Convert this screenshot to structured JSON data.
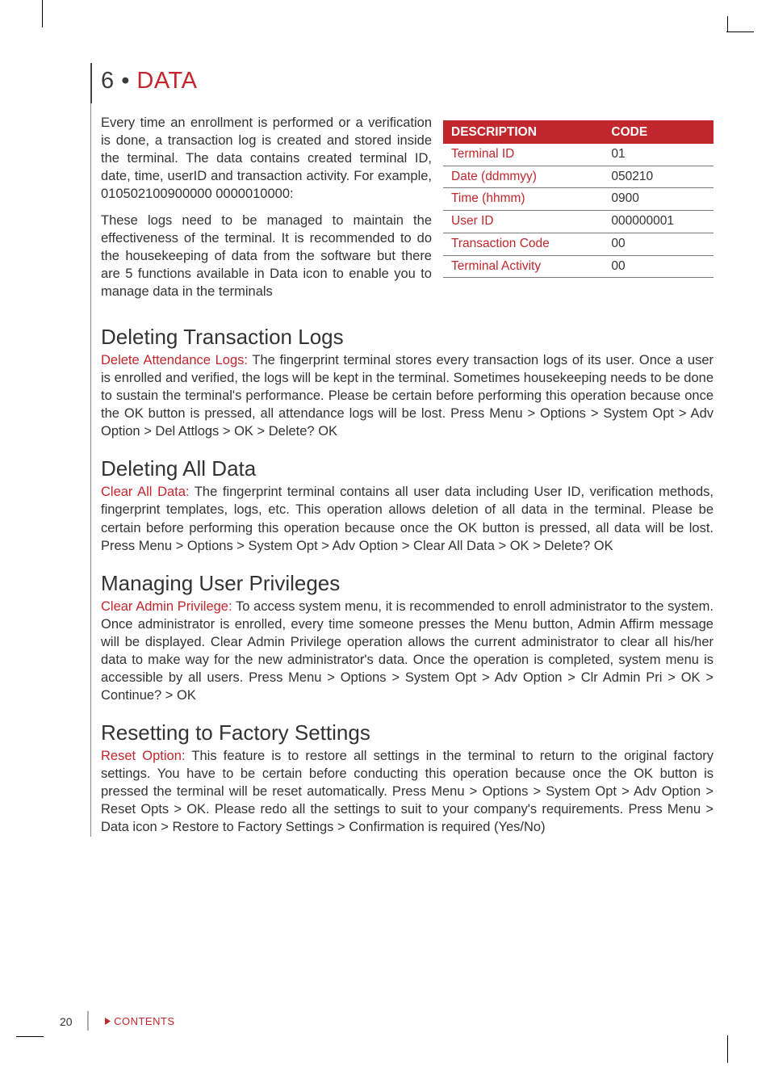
{
  "chapter": {
    "number": "6",
    "separator": "•",
    "title": "DATA"
  },
  "intro": {
    "p1": "Every time an enrollment is performed or a verification is done, a transaction log is created and stored inside the terminal. The data contains created terminal ID, date, time, userID and transaction activity. For example, 010502100900000 0000010000:",
    "p2": "These logs need to be managed to maintain the effectiveness of the terminal. It is recommended to do the housekeeping of data from the software but there are 5 functions available in Data icon to enable you to manage data in the terminals"
  },
  "table": {
    "headers": {
      "desc": "DESCRIPTION",
      "code": "CODE"
    },
    "rows": [
      {
        "desc": "Terminal ID",
        "code": "01"
      },
      {
        "desc": "Date (ddmmyy)",
        "code": "050210"
      },
      {
        "desc": "Time (hhmm)",
        "code": "0900"
      },
      {
        "desc": "User ID",
        "code": "000000001"
      },
      {
        "desc": "Transaction Code",
        "code": "00"
      },
      {
        "desc": "Terminal Activity",
        "code": "00"
      }
    ]
  },
  "sections": {
    "s1": {
      "title": "Deleting Transaction Logs",
      "lead": "Delete Attendance Logs: ",
      "body": "The fingerprint terminal stores every transaction logs of its user. Once a user is enrolled and verified, the logs will be kept in the terminal. Sometimes housekeeping needs to be done to sustain the terminal's performance. Please be certain before performing this operation because once the OK button is pressed, all attendance logs will be lost.  Press Menu > Options > System Opt > Adv Option > Del Attlogs > OK > Delete? OK"
    },
    "s2": {
      "title": "Deleting All Data",
      "lead": "Clear All Data: ",
      "body": "The fingerprint terminal contains all user data including User ID, verification methods, fingerprint templates, logs, etc. This operation allows deletion of all data in the terminal. Please be certain before performing this operation because once the OK button is pressed, all data will be lost.  Press Menu > Options > System Opt > Adv Option > Clear All Data > OK > Delete? OK"
    },
    "s3": {
      "title": "Managing User Privileges",
      "lead": "Clear Admin Privilege: ",
      "body": "To access system menu, it is recommended to enroll administrator to the system. Once administrator is enrolled, every time someone presses the Menu button, Admin Affirm message will be displayed. Clear Admin Privilege operation allows the current administrator to clear all his/her data to make way for the new administrator's data. Once the operation is completed, system menu is accessible by all users.  Press Menu > Options > System Opt > Adv Option > Clr Admin Pri > OK > Continue? > OK"
    },
    "s4": {
      "title": "Resetting to Factory Settings",
      "lead": "Reset Option: ",
      "body": "This feature is to restore all settings in the terminal to return to the original factory settings. You have to be certain before conducting this operation because once the OK button is pressed the terminal will be reset automatically. Press Menu > Options > System Opt > Adv Option > Reset Opts > OK. Please redo all the settings to suit to your company's requirements. Press Menu > Data icon > Restore to Factory Settings > Confirmation is required (Yes/No)"
    }
  },
  "footer": {
    "page": "20",
    "contents": "CONTENTS"
  }
}
